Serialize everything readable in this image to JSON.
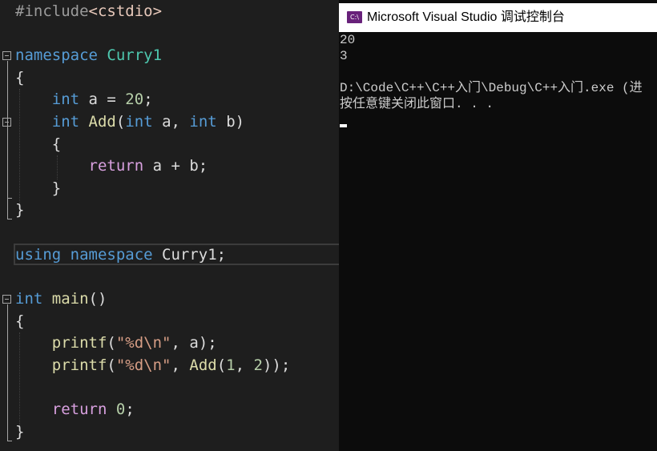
{
  "editor": {
    "l1a": "#include",
    "l1b": "<cstdio>",
    "l3a": "namespace",
    "l3b": " Curry1",
    "l4": "{",
    "l5a": "int",
    "l5b": " a = ",
    "l5c": "20",
    "l5d": ";",
    "l6a": "int",
    "l6b": " ",
    "l6c": "Add",
    "l6d": "(",
    "l6e": "int",
    "l6f": " a, ",
    "l6g": "int",
    "l6h": " b)",
    "l7": "{",
    "l8a": "return",
    "l8b": " a + b;",
    "l9": "}",
    "l10": "}",
    "l12a": "using",
    "l12b": " ",
    "l12c": "namespace",
    "l12d": " Curry1;",
    "l14a": "int",
    "l14b": " ",
    "l14c": "main",
    "l14d": "()",
    "l15": "{",
    "l16a": "printf",
    "l16b": "(",
    "l16c": "\"%d\\n\"",
    "l16d": ", a);",
    "l17a": "printf",
    "l17b": "(",
    "l17c": "\"%d\\n\"",
    "l17d": ", ",
    "l17e": "Add",
    "l17f": "(",
    "l17g": "1",
    "l17h": ", ",
    "l17i": "2",
    "l17j": "));",
    "l19a": "return",
    "l19b": " ",
    "l19c": "0",
    "l19d": ";",
    "l20": "}"
  },
  "console": {
    "title": "Microsoft Visual Studio 调试控制台",
    "icon_label": "C:\\",
    "icon_name": "vs-console-icon",
    "line1": "20",
    "line2": "3",
    "line3": "D:\\Code\\C++\\C++入门\\Debug\\C++入门.exe (进",
    "line4": "按任意键关闭此窗口. . ."
  },
  "colors": {
    "editor_bg": "#1e1e1e",
    "keyword": "#569cd6",
    "function": "#dcdcaa",
    "string": "#d69d85",
    "number": "#b5cea8",
    "control": "#d8a0df",
    "console_bg": "#0c0c0c",
    "console_text": "#cccccc",
    "vs_purple": "#68217a"
  }
}
